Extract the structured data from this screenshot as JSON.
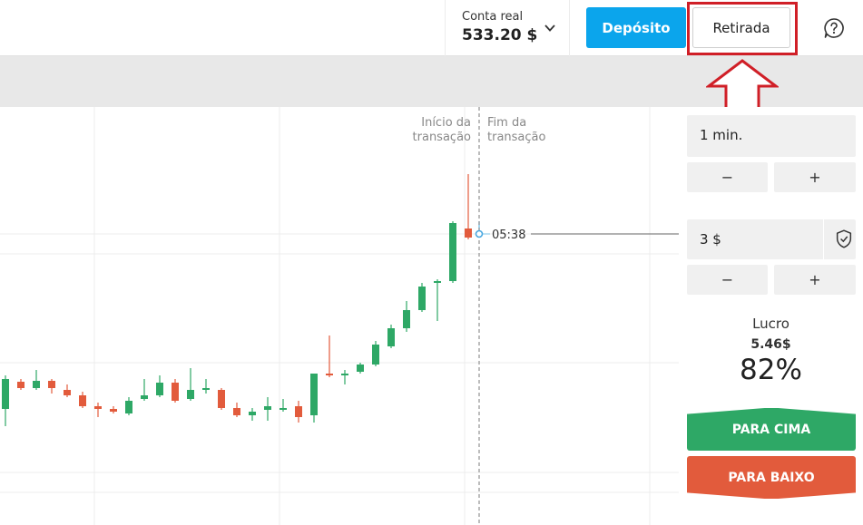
{
  "header": {
    "account_label": "Conta real",
    "account_balance": "533.20 $",
    "deposit_label": "Depósito",
    "withdraw_label": "Retirada"
  },
  "chart": {
    "start_label_line1": "Início da",
    "start_label_line2": "transação",
    "end_label_line1": "Fim da",
    "end_label_line2": "transação",
    "time_readout": "05:38",
    "up_color": "#2ea866",
    "down_color": "#e25b3c"
  },
  "trade": {
    "duration": "1 min.",
    "amount": "3 $",
    "minus": "−",
    "plus": "+",
    "profit_label": "Lucro",
    "profit_amount": "5.46$",
    "profit_percent": "82%",
    "up_label": "PARA CIMA",
    "down_label": "PARA BAIXO"
  },
  "accent_colors": {
    "deposit": "#0ba5ec",
    "highlight": "#d01f27",
    "up": "#2ea866",
    "down": "#e25b3c"
  }
}
